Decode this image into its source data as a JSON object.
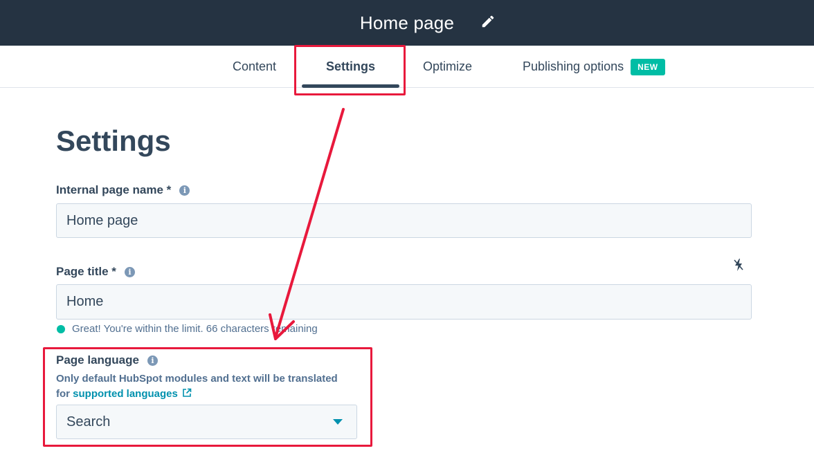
{
  "header": {
    "title": "Home page"
  },
  "tabs": [
    {
      "label": "Content"
    },
    {
      "label": "Settings"
    },
    {
      "label": "Optimize"
    },
    {
      "label": "Publishing options",
      "badge": "NEW"
    }
  ],
  "main": {
    "heading": "Settings",
    "internal_name": {
      "label": "Internal page name *",
      "value": "Home page"
    },
    "page_title": {
      "label": "Page title *",
      "value": "Home",
      "hint": "Great! You're within the limit. 66 characters remaining"
    },
    "page_language": {
      "label": "Page language",
      "desc_line1": "Only default HubSpot modules and text will be translated",
      "desc_prefix": "for ",
      "link": "supported languages",
      "placeholder": "Search"
    }
  },
  "colors": {
    "topbar": "#253342",
    "accent": "#00bda5",
    "link": "#0091ae",
    "annotation": "#e8193c"
  }
}
